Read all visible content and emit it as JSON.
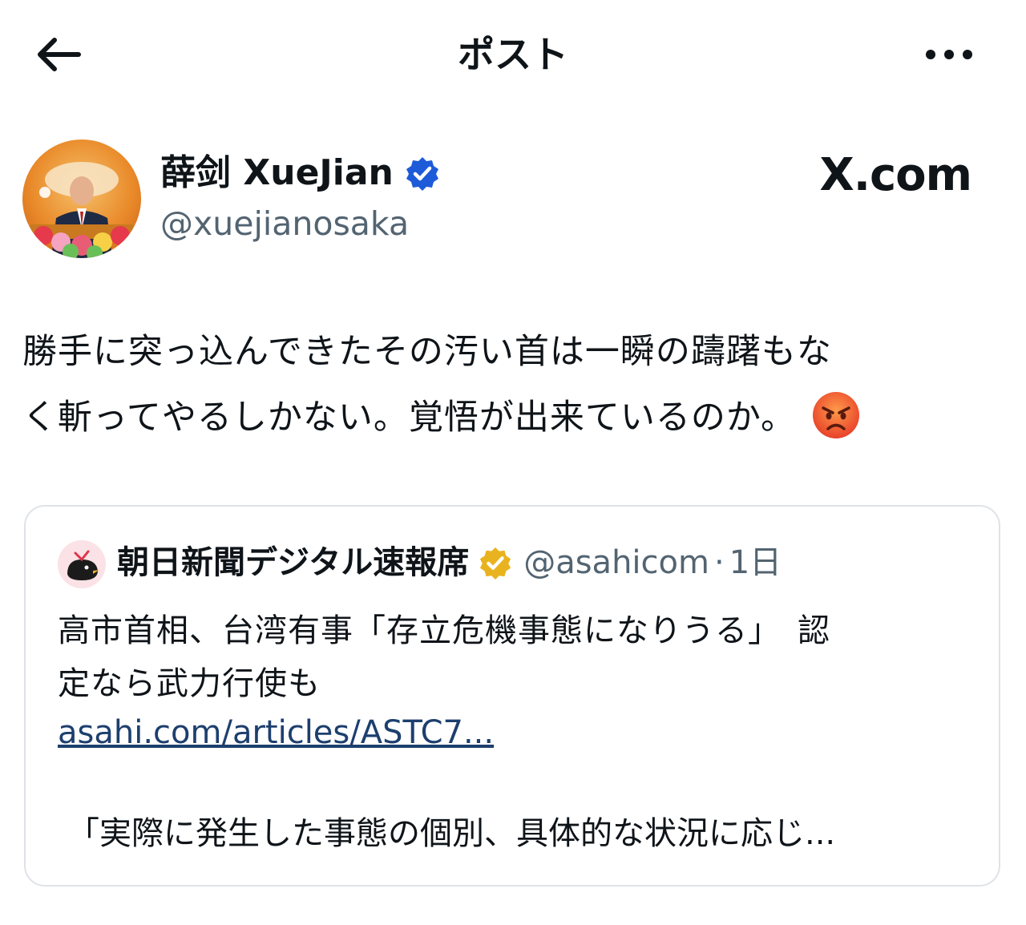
{
  "header": {
    "title": "ポスト",
    "back_icon": "arrow-left-icon",
    "more_icon": "more-horizontal-icon"
  },
  "author": {
    "display_name": "薛剑 XueJian",
    "handle": "@xuejianosaka",
    "verified_badge": "verified-badge-icon",
    "verified_color": "#1d5bd8"
  },
  "watermark": "X.com",
  "post": {
    "lines": [
      "勝手に突っ込んできたその汚い首は一瞬の躊躇もな",
      "く斬ってやるしかない。覚悟が出来ているのか。"
    ],
    "emoji": "angry-face-emoji"
  },
  "quote": {
    "name": "朝日新聞デジタル速報席",
    "handle": "@asahicom",
    "separator": "·",
    "time": "1日",
    "gold_badge_color": "#e9b320",
    "text_lines": [
      "高市首相、台湾有事「存立危機事態になりうる」　認",
      "定なら武力行使も"
    ],
    "link": "asahi.com/articles/ASTC7...",
    "excerpt": "「実際に発生した事態の個別、具体的な状況に応じ..."
  },
  "colors": {
    "text": "#0f1419",
    "secondary": "#536471",
    "border": "#dfe3e7",
    "link": "#1d3f6e"
  }
}
